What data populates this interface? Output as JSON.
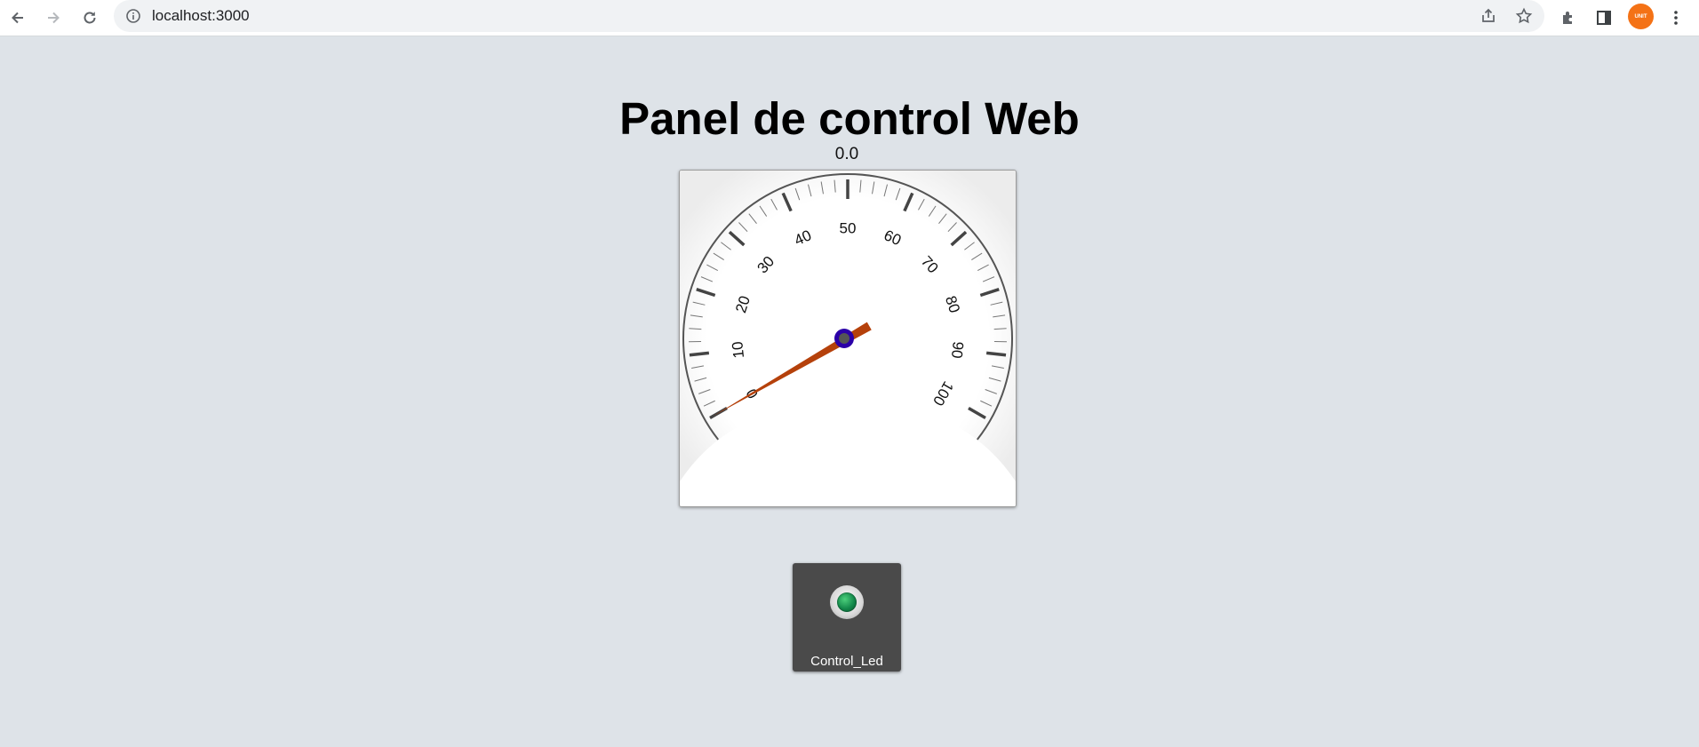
{
  "browser": {
    "url": "localhost:3000",
    "profile_badge": "UNIT"
  },
  "page": {
    "title": "Panel de control Web"
  },
  "gauge": {
    "value_text": "0.0",
    "value": 0,
    "min": 0,
    "max": 100,
    "labels": [
      "0",
      "10",
      "20",
      "30",
      "40",
      "50",
      "60",
      "70",
      "80",
      "90",
      "100"
    ],
    "needle_color": "#b5410b",
    "hub_color": "#2b00a8"
  },
  "led_widget": {
    "label": "Control_Led",
    "state_color": "#13884a"
  }
}
